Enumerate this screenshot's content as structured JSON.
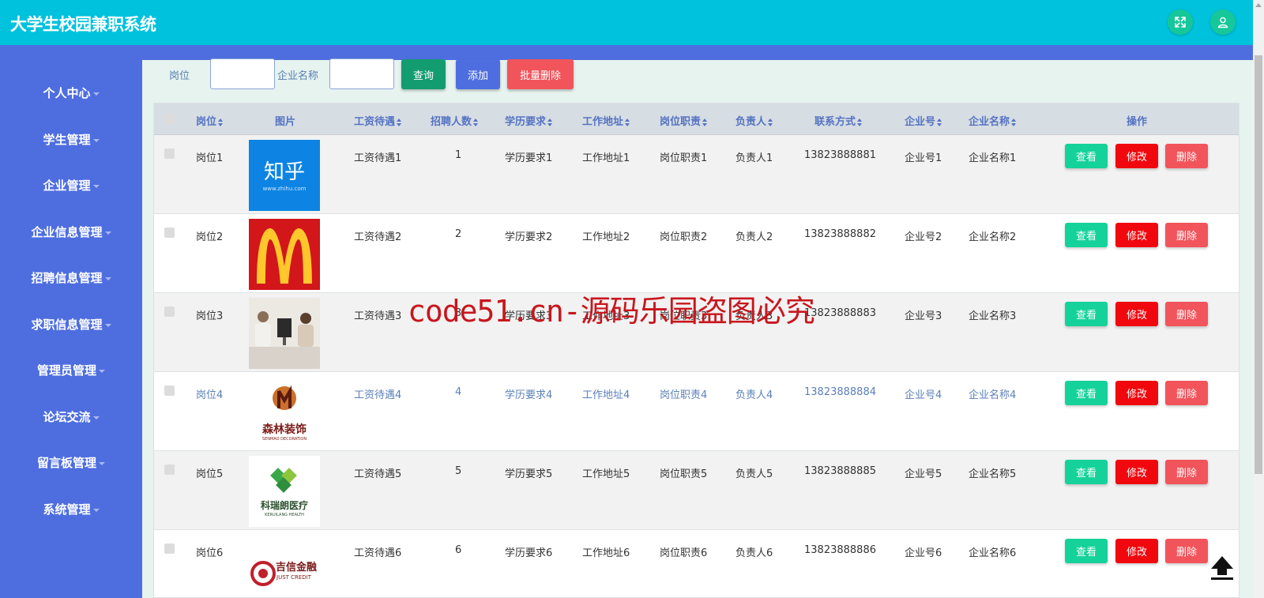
{
  "app": {
    "title": "大学生校园兼职系统"
  },
  "topbar": {
    "fullscreen_icon": "expand-icon",
    "user_icon": "user-icon",
    "accent": "#00c2dc",
    "button_color": "#16c79a"
  },
  "sidebar": {
    "color": "#4e6ee0",
    "items": [
      {
        "label": "个人中心"
      },
      {
        "label": "学生管理"
      },
      {
        "label": "企业管理"
      },
      {
        "label": "企业信息管理"
      },
      {
        "label": "招聘信息管理"
      },
      {
        "label": "求职信息管理"
      },
      {
        "label": "管理员管理"
      },
      {
        "label": "论坛交流"
      },
      {
        "label": "留言板管理"
      },
      {
        "label": "系统管理"
      }
    ]
  },
  "search": {
    "position_label": "岗位",
    "position_value": "",
    "company_label": "企业名称",
    "company_value": "",
    "query_button": "查询",
    "add_button": "添加",
    "batch_delete_button": "批量删除"
  },
  "table": {
    "headers": [
      "岗位",
      "图片",
      "工资待遇",
      "招聘人数",
      "学历要求",
      "工作地址",
      "岗位职责",
      "负责人",
      "联系方式",
      "企业号",
      "企业名称",
      "操作"
    ],
    "actions": {
      "view": "查看",
      "edit": "修改",
      "delete": "删除"
    },
    "rows": [
      {
        "position": "岗位1",
        "image": "zhihu-logo",
        "salary": "工资待遇1",
        "count": "1",
        "education": "学历要求1",
        "address": "工作地址1",
        "duty": "岗位职责1",
        "manager": "负责人1",
        "phone": "13823888881",
        "company_no": "企业号1",
        "company_name": "企业名称1"
      },
      {
        "position": "岗位2",
        "image": "mcdonalds-logo",
        "salary": "工资待遇2",
        "count": "2",
        "education": "学历要求2",
        "address": "工作地址2",
        "duty": "岗位职责2",
        "manager": "负责人2",
        "phone": "13823888882",
        "company_no": "企业号2",
        "company_name": "企业名称2"
      },
      {
        "position": "岗位3",
        "image": "office-photo",
        "salary": "工资待遇3",
        "count": "3",
        "education": "学历要求3",
        "address": "工作地址3",
        "duty": "岗位职责3",
        "manager": "负责人3",
        "phone": "13823888883",
        "company_no": "企业号3",
        "company_name": "企业名称3"
      },
      {
        "position": "岗位4",
        "image": "decoration-logo",
        "salary": "工资待遇4",
        "count": "4",
        "education": "学历要求4",
        "address": "工作地址4",
        "duty": "岗位职责4",
        "manager": "负责人4",
        "phone": "13823888884",
        "company_no": "企业号4",
        "company_name": "企业名称4"
      },
      {
        "position": "岗位5",
        "image": "medical-logo",
        "salary": "工资待遇5",
        "count": "5",
        "education": "学历要求5",
        "address": "工作地址5",
        "duty": "岗位职责5",
        "manager": "负责人5",
        "phone": "13823888885",
        "company_no": "企业号5",
        "company_name": "企业名称5"
      },
      {
        "position": "岗位6",
        "image": "credit-logo",
        "salary": "工资待遇6",
        "count": "6",
        "education": "学历要求6",
        "address": "工作地址6",
        "duty": "岗位职责6",
        "manager": "负责人6",
        "phone": "13823888886",
        "company_no": "企业号6",
        "company_name": "企业名称6"
      }
    ]
  },
  "logos": {
    "zhihu_text": "知乎",
    "zhihu_url": "www.zhihu.com",
    "decoration_text": "森林装饰",
    "decoration_sub": "SENMAO DECORATION",
    "medical_text": "科瑞朗医疗",
    "medical_sub": "KERUILANG HEALTH",
    "credit_text": "吉信金融",
    "credit_sub": "JUST CREDIT"
  },
  "watermark": {
    "text": "code51.cn-源码乐园盗图必究"
  },
  "colors": {
    "view_btn": "#15d29a",
    "edit_btn": "#f0080e",
    "delete_btn": "#f2545b",
    "query_btn": "#139c6f",
    "add_btn": "#4e6ee0",
    "batch_btn": "#f2545b"
  },
  "back_to_top_icon": "arrow-up-icon"
}
